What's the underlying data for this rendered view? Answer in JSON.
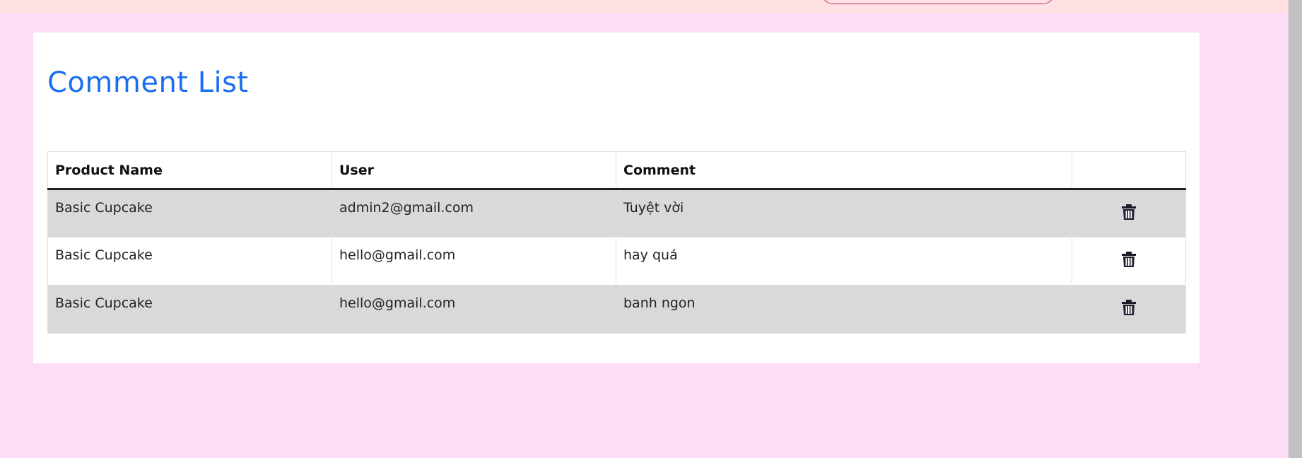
{
  "page": {
    "title": "Comment List"
  },
  "table": {
    "headers": {
      "product": "Product Name",
      "user": "User",
      "comment": "Comment",
      "actions": ""
    },
    "rows": [
      {
        "product": "Basic Cupcake",
        "user": "admin2@gmail.com",
        "comment": "Tuyệt vời",
        "action_icon": "trash-icon"
      },
      {
        "product": "Basic Cupcake",
        "user": "hello@gmail.com",
        "comment": "hay quá",
        "action_icon": "trash-icon"
      },
      {
        "product": "Basic Cupcake",
        "user": "hello@gmail.com",
        "comment": "banh ngon",
        "action_icon": "trash-icon"
      }
    ]
  },
  "colors": {
    "page_background": "#fcdcf6",
    "topbar_background": "#ffe1e4",
    "title": "#1a6ef0",
    "striped_row": "#d9d9d9",
    "icon": "#1c1c2e"
  }
}
